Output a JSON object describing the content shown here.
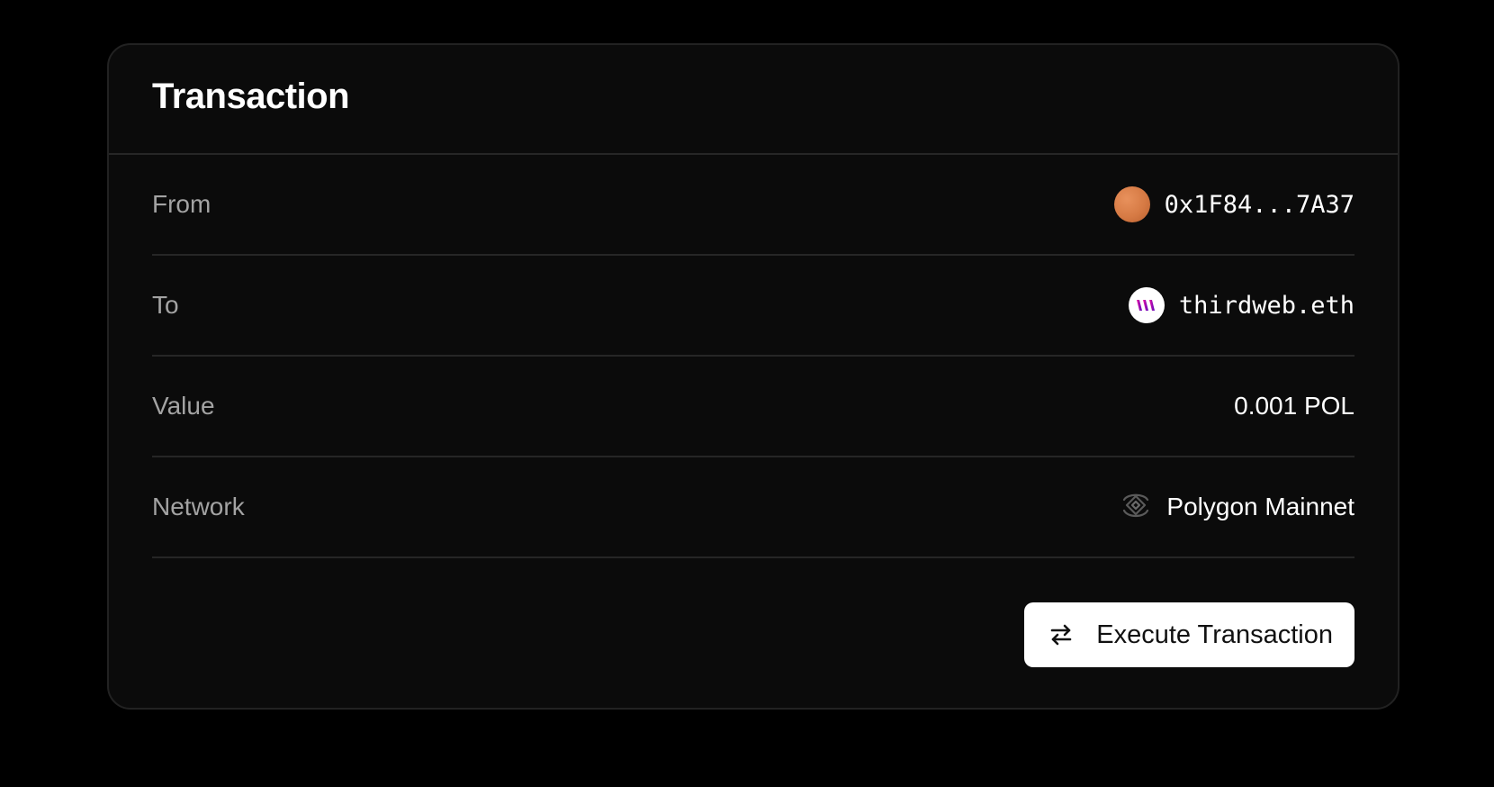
{
  "card": {
    "title": "Transaction"
  },
  "rows": [
    {
      "label": "From",
      "value": "0x1F84...7A37",
      "icon": "orange-avatar"
    },
    {
      "label": "To",
      "value": "thirdweb.eth",
      "icon": "thirdweb-logo"
    },
    {
      "label": "Value",
      "value": "0.001 POL"
    },
    {
      "label": "Network",
      "value": "Polygon Mainnet",
      "icon": "polygon-network-icon"
    }
  ],
  "actions": {
    "execute_label": "Execute Transaction",
    "execute_icon": "swap-arrows-icon"
  },
  "colors": {
    "background": "#000000",
    "card": "#0b0b0b",
    "border": "#262626",
    "label": "#a3a3a3",
    "value": "#ffffff",
    "avatar_orange": "#d67a44",
    "thirdweb_brand": "#c026d3",
    "button_bg": "#ffffff",
    "button_text": "#111111"
  }
}
